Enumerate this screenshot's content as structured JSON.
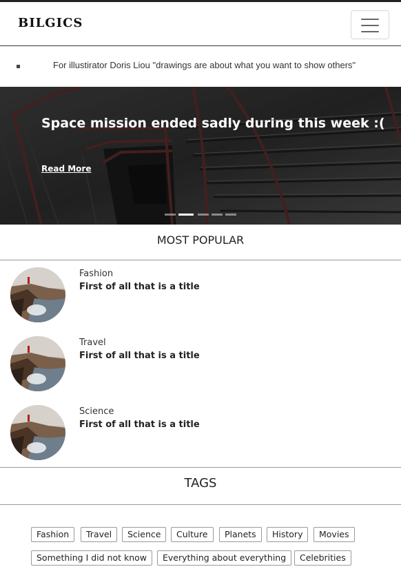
{
  "header": {
    "logo": "BILGICS",
    "menu_icon": "hamburger-icon"
  },
  "ticker": {
    "text": "For illustirator Doris Liou \"drawings are about what you want to show others\""
  },
  "hero": {
    "title": "Space mission ended sadly during this week :(",
    "read_more": "Read More",
    "slide_count": 5,
    "active_slide": 2
  },
  "most_popular": {
    "heading": "MOST POPULAR",
    "posts": [
      {
        "category": "Fashion",
        "title": "First of all that is a title"
      },
      {
        "category": "Travel",
        "title": "First of all that is a title"
      },
      {
        "category": "Science",
        "title": "First of all that is a title"
      }
    ]
  },
  "tags": {
    "heading": "TAGS",
    "items": [
      "Fashion",
      "Travel",
      "Science",
      "Culture",
      "Planets",
      "History",
      "Movies",
      "Something I did not know",
      "Everything about everything",
      "Celebrities"
    ]
  }
}
